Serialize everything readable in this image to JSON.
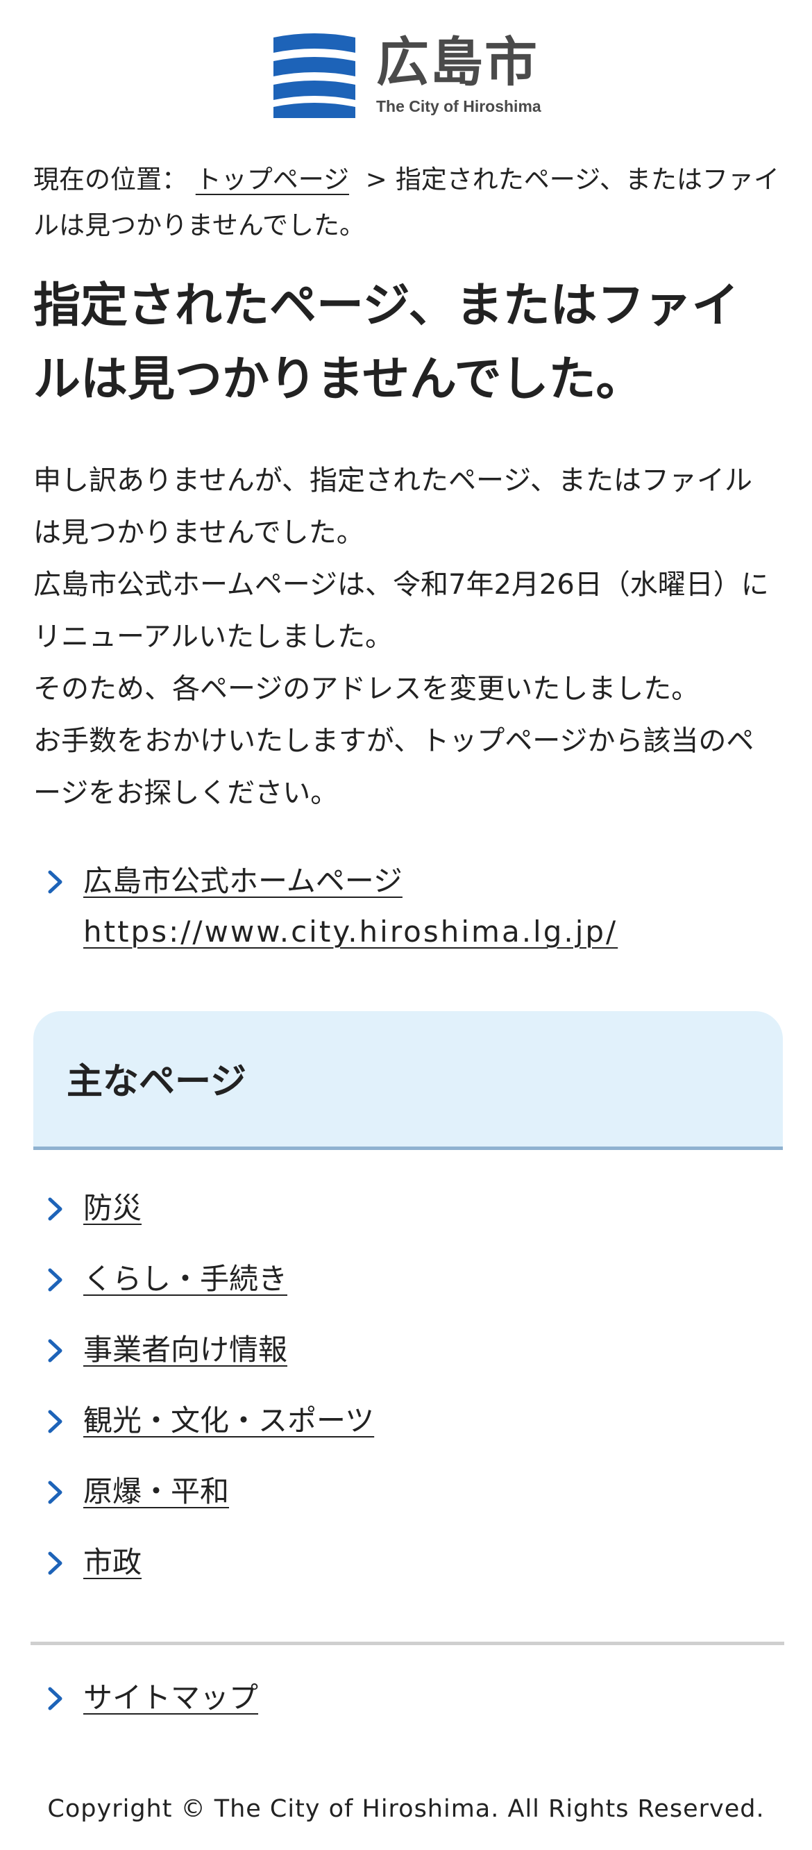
{
  "header": {
    "logo_kanji": "広島市",
    "logo_sub": "The City of Hiroshima",
    "brand_color": "#1d63b8"
  },
  "breadcrumb": {
    "prefix": "現在の位置：",
    "top_link": "トップページ",
    "separator": ">",
    "current": "指定されたページ、またはファイルは見つかりませんでした。"
  },
  "page_title": "指定されたページ、またはファイルは見つかりませんでした。",
  "body": {
    "paragraphs": [
      "申し訳ありませんが、指定されたページ、またはファイルは見つかりませんでした。",
      "広島市公式ホームページは、令和7年2月26日（水曜日）にリニューアルいたしました。",
      "そのため、各ページのアドレスを変更いたしました。",
      "お手数をおかけいたしますが、トップページから該当のページをお探しください。"
    ]
  },
  "home_link": {
    "label": "広島市公式ホームページ",
    "url": "https://www.city.hiroshima.lg.jp/"
  },
  "main_pages": {
    "title": "主なページ",
    "items": [
      {
        "label": "防災"
      },
      {
        "label": "くらし・手続き"
      },
      {
        "label": "事業者向け情報"
      },
      {
        "label": "観光・文化・スポーツ"
      },
      {
        "label": "原爆・平和"
      },
      {
        "label": "市政"
      }
    ]
  },
  "sitemap": {
    "label": "サイトマップ"
  },
  "footer": {
    "copyright": "Copyright © The City of Hiroshima. All Rights Reserved."
  },
  "colors": {
    "accent_blue": "#1d63b8",
    "box_background": "#e1f1fb",
    "box_border": "#8fb2d0",
    "divider": "#cfcfcf"
  }
}
